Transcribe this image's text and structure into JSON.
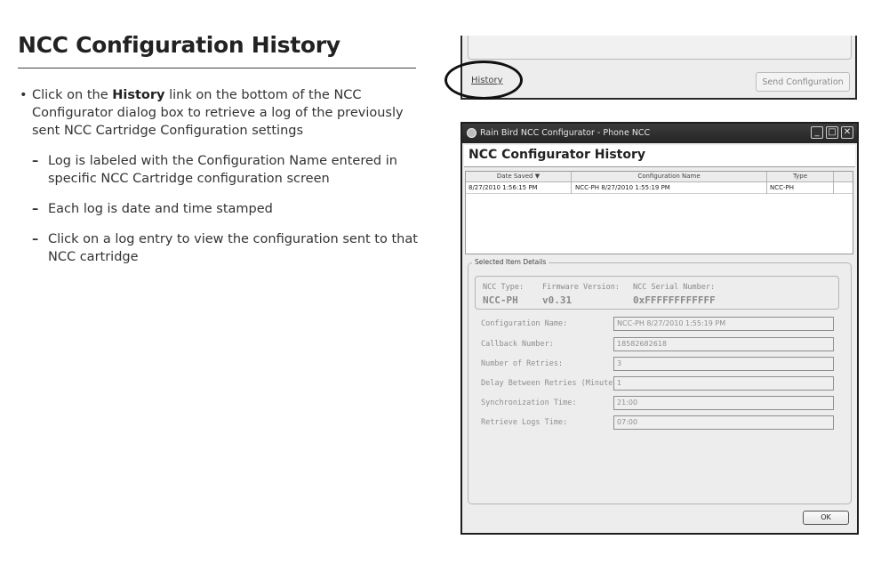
{
  "doc": {
    "title": "NCC Configuration History",
    "bullet_pre": "Click on the ",
    "bullet_bold": "History",
    "bullet_post": " link on the bottom of the NCC Configurator dialog box to retrieve a log of the previously sent NCC Cartridge Configuration settings",
    "subs": [
      "Log is labeled with the Configuration Name entered in specific NCC Cartridge configuration screen",
      "Each log is date and time stamped",
      "Click on a log entry to view the configuration sent to that NCC cartridge"
    ]
  },
  "top_dialog": {
    "history_link": "History",
    "send_button": "Send Configuration"
  },
  "dialog": {
    "window_title": "Rain Bird NCC Configurator - Phone NCC",
    "heading": "NCC Configurator History",
    "columns": [
      "Date Saved ▼",
      "Configuration Name",
      "Type"
    ],
    "rows": [
      {
        "date": "8/27/2010 1:56:15 PM",
        "name": "NCC-PH 8/27/2010 1:55:19 PM",
        "type": "NCC-PH"
      }
    ],
    "details_legend": "Selected Item Details",
    "info": {
      "type_label": "NCC Type:",
      "type_value": "NCC-PH",
      "fw_label": "Firmware Version:",
      "fw_value": "v0.31",
      "serial_label": "NCC Serial Number:",
      "serial_value": "0xFFFFFFFFFFFF"
    },
    "fields": [
      {
        "label": "Configuration Name:",
        "value": "NCC-PH 8/27/2010 1:55:19 PM"
      },
      {
        "label": "Callback Number:",
        "value": "18582682618"
      },
      {
        "label": "Number of Retries:",
        "value": "3"
      },
      {
        "label": "Delay Between Retries (Minutes):",
        "value": "1"
      },
      {
        "label": "Synchronization Time:",
        "value": "21:00"
      },
      {
        "label": "Retrieve Logs Time:",
        "value": "07:00"
      }
    ],
    "ok_button": "OK"
  }
}
